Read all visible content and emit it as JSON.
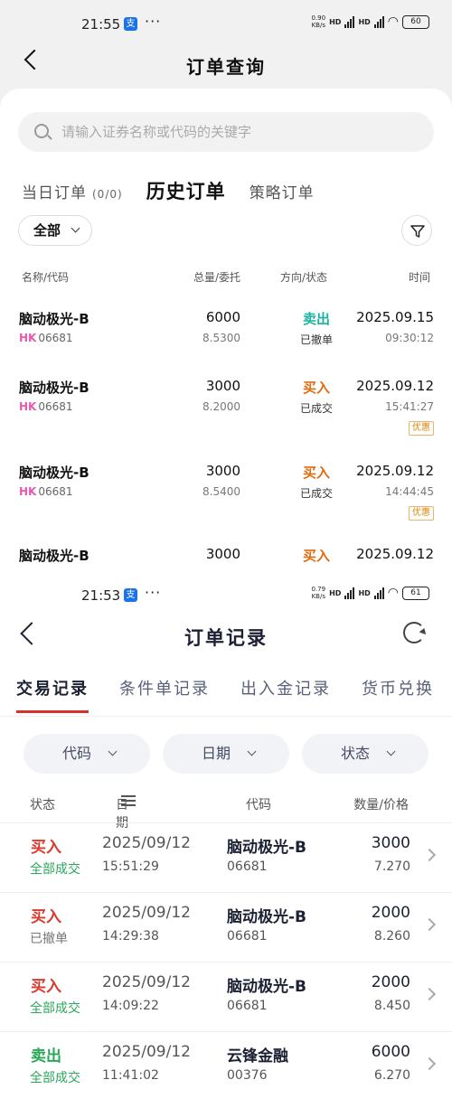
{
  "top_status": {
    "time": "21:55",
    "app_badge": "支",
    "dots": "···",
    "speed_top": "0.90",
    "speed_unit": "KB/s",
    "hd1": "HD",
    "hd2": "HD",
    "battery": "60"
  },
  "top": {
    "title": "订单查询",
    "search_placeholder": "请输入证券名称或代码的关键字",
    "tabs": [
      {
        "label": "当日订单",
        "count": "(0/0)"
      },
      {
        "label": "历史订单"
      },
      {
        "label": "策略订单"
      }
    ],
    "filter_label": "全部",
    "headers": {
      "name": "名称/代码",
      "qty": "总量/委托",
      "dir": "方向/状态",
      "time": "时间"
    },
    "orders": [
      {
        "name": "脑动极光-B",
        "market": "HK",
        "code": "06681",
        "qty": "6000",
        "price": "8.5300",
        "direction": "卖出",
        "status": "已撤单",
        "date": "2025.09.15",
        "time": "09:30:12",
        "tag": ""
      },
      {
        "name": "脑动极光-B",
        "market": "HK",
        "code": "06681",
        "qty": "3000",
        "price": "8.2000",
        "direction": "买入",
        "status": "已成交",
        "date": "2025.09.12",
        "time": "15:41:27",
        "tag": "优惠"
      },
      {
        "name": "脑动极光-B",
        "market": "HK",
        "code": "06681",
        "qty": "3000",
        "price": "8.5400",
        "direction": "买入",
        "status": "已成交",
        "date": "2025.09.12",
        "time": "14:44:45",
        "tag": "优惠"
      },
      {
        "name": "脑动极光-B",
        "qty": "3000",
        "direction": "买入",
        "date": "2025.09.12"
      }
    ]
  },
  "bottom_status": {
    "time": "21:53",
    "app_badge": "支",
    "dots": "···",
    "speed_top": "0.79",
    "speed_unit": "KB/s",
    "hd1": "HD",
    "hd2": "HD",
    "battery": "61"
  },
  "bottom": {
    "title": "订单记录",
    "tabs": [
      "交易记录",
      "条件单记录",
      "出入金记录",
      "货币兑换"
    ],
    "chips": [
      "代码",
      "日期",
      "状态"
    ],
    "headers": {
      "status": "状态",
      "date": "日期",
      "code": "代码",
      "qty": "数量/价格"
    },
    "records": [
      {
        "direction": "买入",
        "status": "全部成交",
        "date": "2025/09/12",
        "time": "15:51:29",
        "name": "脑动极光-B",
        "code": "06681",
        "qty": "3000",
        "price": "7.270"
      },
      {
        "direction": "买入",
        "status": "已撤单",
        "date": "2025/09/12",
        "time": "14:29:38",
        "name": "脑动极光-B",
        "code": "06681",
        "qty": "2000",
        "price": "8.260"
      },
      {
        "direction": "买入",
        "status": "全部成交",
        "date": "2025/09/12",
        "time": "14:09:22",
        "name": "脑动极光-B",
        "code": "06681",
        "qty": "2000",
        "price": "8.450"
      },
      {
        "direction": "卖出",
        "status": "全部成交",
        "date": "2025/09/12",
        "time": "11:41:02",
        "name": "云锋金融",
        "code": "00376",
        "qty": "6000",
        "price": "6.270"
      }
    ]
  },
  "colors": {
    "sell_top": "#19b3a1",
    "buy_top": "#e06b10",
    "buy_bottom": "#d93a2d",
    "sell_bottom": "#2aa85a",
    "hk_tag": "#e55ab0",
    "tab_indicator": "#d9302d"
  }
}
